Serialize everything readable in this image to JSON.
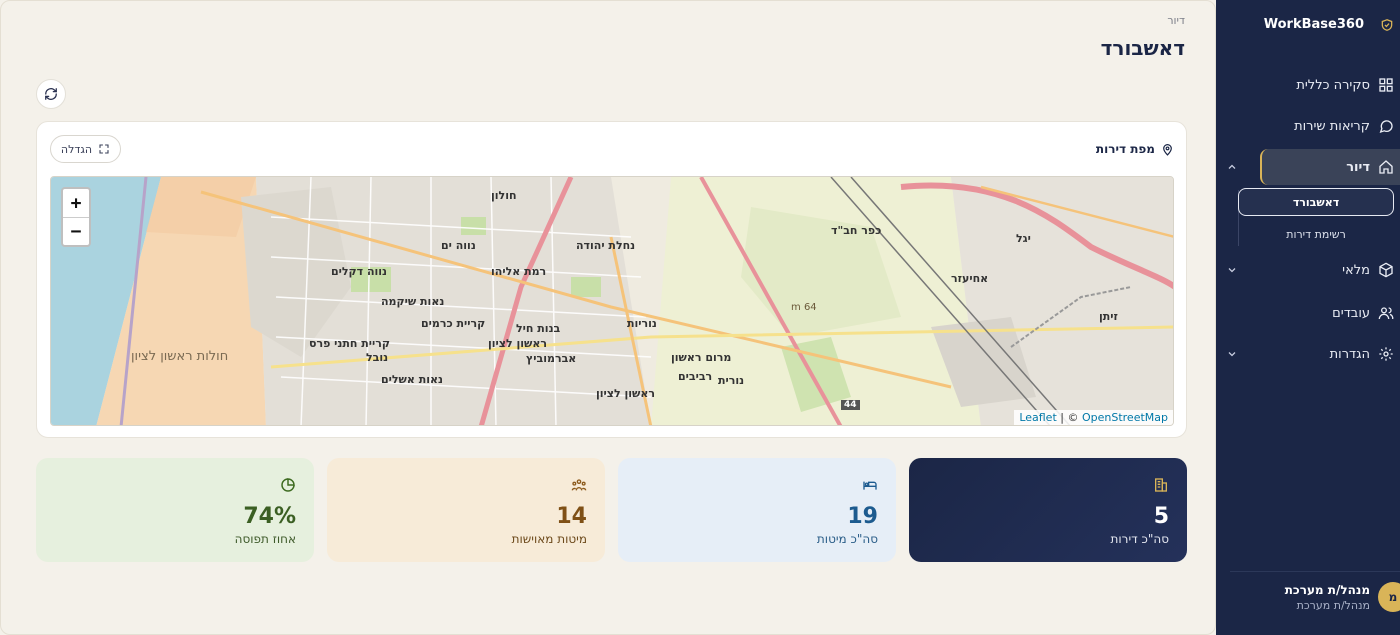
{
  "sidebar": {
    "brand": "WorkBase360",
    "items": [
      {
        "label": "סקירה כללית",
        "icon": "grid-icon"
      },
      {
        "label": "קריאות שירות",
        "icon": "chat-bubble-icon"
      },
      {
        "label": "דיור",
        "icon": "home-icon",
        "expanded": true
      },
      {
        "label": "מלאי",
        "icon": "box-icon"
      },
      {
        "label": "עובדים",
        "icon": "users-icon"
      },
      {
        "label": "הגדרות",
        "icon": "gear-icon"
      }
    ],
    "sub_items": [
      {
        "label": "דאשבורד",
        "active": true
      },
      {
        "label": "רשימת דירות",
        "active": false
      }
    ],
    "user": {
      "initial": "מ",
      "name": "מנהל/ת מערכת",
      "role": "מנהל/ת מערכת"
    }
  },
  "header": {
    "breadcrumb": "דיור",
    "title": "דאשבורד"
  },
  "map": {
    "title": "מפת דירות",
    "expand_label": "הגדלה",
    "zoom_in": "+",
    "zoom_out": "−",
    "attribution_leaflet": "Leaflet",
    "attribution_sep": " | © ",
    "attribution_osm": "OpenStreetMap",
    "labels": [
      "חולות ראשון לציון",
      "נווה ים",
      "רמת אליהו",
      "נחלת יהודה",
      "נאות שיקמה",
      "קריית כרמים",
      "בנות חיל",
      "ראשון לציון",
      "קריית חתני פרס",
      "נובל",
      "נאות אשלים",
      "אברמוביץ",
      "מרום ראשון",
      "רביבים",
      "נורית",
      "נוריות",
      "ראשון לציון",
      "נווה דקלים",
      "כפר חב\"ד",
      "אחיעזר",
      "יגל",
      "זיתן",
      "חולון",
      "64 m",
      "44"
    ]
  },
  "stats": [
    {
      "value": "5",
      "label": "סה\"כ דירות",
      "icon": "building-icon"
    },
    {
      "value": "19",
      "label": "סה\"כ מיטות",
      "icon": "bed-icon"
    },
    {
      "value": "14",
      "label": "מיטות מאוישות",
      "icon": "people-icon"
    },
    {
      "value": "74%",
      "label": "אחוז תפוסה",
      "icon": "pie-chart-icon"
    }
  ],
  "colors": {
    "sidebar_bg": "#1b2646",
    "accent_gold": "#d9b458",
    "page_bg": "#f4f1ea"
  }
}
